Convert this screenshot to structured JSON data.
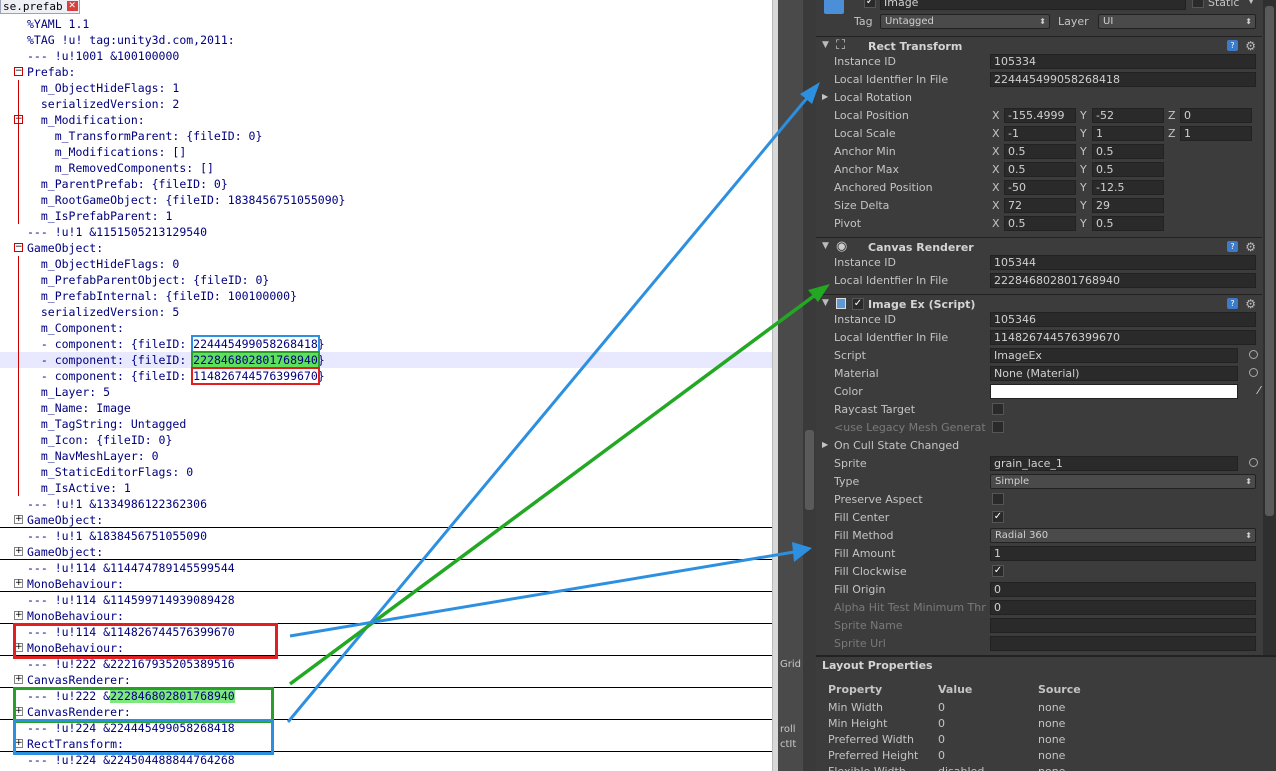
{
  "editor": {
    "tab_title": "se.prefab",
    "lines": [
      {
        "text": "%YAML 1.1",
        "kind": "plain"
      },
      {
        "text": "%TAG !u! tag:unity3d.com,2011:",
        "kind": "plain"
      },
      {
        "text": "--- !u!1001 &100100000",
        "kind": "doc"
      },
      {
        "text": "Prefab:",
        "kind": "key",
        "fold": "-"
      },
      {
        "text": "  m_ObjectHideFlags: 1",
        "kind": "kv"
      },
      {
        "text": "  serializedVersion: 2",
        "kind": "kv"
      },
      {
        "text": "  m_Modification:",
        "kind": "kv",
        "fold": "-"
      },
      {
        "text": "    m_TransformParent: {fileID: 0}",
        "kind": "kv"
      },
      {
        "text": "    m_Modifications: []",
        "kind": "kv"
      },
      {
        "text": "    m_RemovedComponents: []",
        "kind": "kv"
      },
      {
        "text": "  m_ParentPrefab: {fileID: 0}",
        "kind": "kv"
      },
      {
        "text": "  m_RootGameObject: {fileID: 1838456751055090}",
        "kind": "kv"
      },
      {
        "text": "  m_IsPrefabParent: 1",
        "kind": "kv"
      },
      {
        "text": "--- !u!1 &1151505213129540",
        "kind": "doc"
      },
      {
        "text": "GameObject:",
        "kind": "key",
        "fold": "-"
      },
      {
        "text": "  m_ObjectHideFlags: 0",
        "kind": "kv"
      },
      {
        "text": "  m_PrefabParentObject: {fileID: 0}",
        "kind": "kv"
      },
      {
        "text": "  m_PrefabInternal: {fileID: 100100000}",
        "kind": "kv"
      },
      {
        "text": "  serializedVersion: 5",
        "kind": "kv"
      },
      {
        "text": "  m_Component:",
        "kind": "kv"
      },
      {
        "text": "  - component: {fileID: 224445499058268418}",
        "kind": "kv",
        "hl": "blue"
      },
      {
        "text": "  - component: {fileID: 222846802801768940}",
        "kind": "kv",
        "hl": "green",
        "cur": true
      },
      {
        "text": "  - component: {fileID: 114826744576399670}",
        "kind": "kv",
        "hl": "red"
      },
      {
        "text": "  m_Layer: 5",
        "kind": "kv"
      },
      {
        "text": "  m_Name: Image",
        "kind": "kv"
      },
      {
        "text": "  m_TagString: Untagged",
        "kind": "kv"
      },
      {
        "text": "  m_Icon: {fileID: 0}",
        "kind": "kv"
      },
      {
        "text": "  m_NavMeshLayer: 0",
        "kind": "kv"
      },
      {
        "text": "  m_StaticEditorFlags: 0",
        "kind": "kv"
      },
      {
        "text": "  m_IsActive: 1",
        "kind": "kv"
      },
      {
        "text": "--- !u!1 &1334986122362306",
        "kind": "doc"
      },
      {
        "text": "GameObject:",
        "kind": "key",
        "fold": "+",
        "sep": true
      },
      {
        "text": "--- !u!1 &1838456751055090",
        "kind": "doc"
      },
      {
        "text": "GameObject:",
        "kind": "key",
        "fold": "+",
        "sep": true
      },
      {
        "text": "--- !u!114 &114474789145599544",
        "kind": "doc"
      },
      {
        "text": "MonoBehaviour:",
        "kind": "key",
        "fold": "+",
        "sep": true
      },
      {
        "text": "--- !u!114 &114599714939089428",
        "kind": "doc"
      },
      {
        "text": "MonoBehaviour:",
        "kind": "key",
        "fold": "+",
        "sep": true
      },
      {
        "text": "--- !u!114 &114826744576399670",
        "kind": "doc"
      },
      {
        "text": "MonoBehaviour:",
        "kind": "key",
        "fold": "+",
        "sep": true
      },
      {
        "text": "--- !u!222 &222167935205389516",
        "kind": "doc"
      },
      {
        "text": "CanvasRenderer:",
        "kind": "key",
        "fold": "+",
        "sep": true
      },
      {
        "text": "--- !u!222 &222846802801768940",
        "kind": "doc",
        "hl": "greenid"
      },
      {
        "text": "CanvasRenderer:",
        "kind": "key",
        "fold": "+",
        "sep": true
      },
      {
        "text": "--- !u!224 &224445499058268418",
        "kind": "doc"
      },
      {
        "text": "RectTransform:",
        "kind": "key",
        "fold": "+",
        "sep": true
      },
      {
        "text": "--- !u!224 &224504488844764268",
        "kind": "doc"
      }
    ]
  },
  "middle": {
    "grid_label": "Grid",
    "scroll_label": "roll",
    "edit_label": "ctIt"
  },
  "inspector": {
    "object_name": "Image",
    "static_label": "Static",
    "tag_label": "Tag",
    "tag_value": "Untagged",
    "layer_label": "Layer",
    "layer_value": "UI",
    "rect": {
      "title": "Rect Transform",
      "instance_id_label": "Instance ID",
      "instance_id": "105334",
      "local_id_label": "Local Identfier In File",
      "local_id": "224445499058268418",
      "local_rotation": "Local Rotation",
      "local_position": "Local Position",
      "pos": [
        "-155.4999",
        "-52",
        "0"
      ],
      "local_scale": "Local Scale",
      "scale": [
        "-1",
        "1",
        "1"
      ],
      "anchor_min": "Anchor Min",
      "amin": [
        "0.5",
        "0.5"
      ],
      "anchor_max": "Anchor Max",
      "amax": [
        "0.5",
        "0.5"
      ],
      "anchored_position": "Anchored Position",
      "apos": [
        "-50",
        "-12.5"
      ],
      "size_delta": "Size Delta",
      "sd": [
        "72",
        "29"
      ],
      "pivot": "Pivot",
      "pv": [
        "0.5",
        "0.5"
      ]
    },
    "canvas": {
      "title": "Canvas Renderer",
      "instance_id_label": "Instance ID",
      "instance_id": "105344",
      "local_id_label": "Local Identfier In File",
      "local_id": "222846802801768940"
    },
    "imageex": {
      "title": "Image Ex (Script)",
      "instance_id_label": "Instance ID",
      "instance_id": "105346",
      "local_id_label": "Local Identfier In File",
      "local_id": "114826744576399670",
      "script_label": "Script",
      "script_value": "ImageEx",
      "material_label": "Material",
      "material_value": "None (Material)",
      "color_label": "Color",
      "raycast_label": "Raycast Target",
      "legacy_label": "<use Legacy Mesh Generat",
      "cull_label": "On Cull State Changed",
      "sprite_label": "Sprite",
      "sprite_value": "grain_lace_1",
      "type_label": "Type",
      "type_value": "Simple",
      "preserve_label": "Preserve Aspect",
      "fill_center_label": "Fill Center",
      "fill_method_label": "Fill Method",
      "fill_method_value": "Radial 360",
      "fill_amount_label": "Fill Amount",
      "fill_amount_value": "1",
      "fill_clockwise_label": "Fill Clockwise",
      "fill_origin_label": "Fill Origin",
      "fill_origin_value": "0",
      "alpha_label": "Alpha Hit Test Minimum Thr",
      "alpha_value": "0",
      "sprite_name_label": "Sprite Name",
      "sprite_url_label": "Sprite Url"
    },
    "xyz": [
      "X",
      "Y",
      "Z"
    ],
    "check_mark": "✓"
  },
  "layout_props": {
    "title": "Layout Properties",
    "headers": [
      "Property",
      "Value",
      "Source"
    ],
    "rows": [
      [
        "Min Width",
        "0",
        "none"
      ],
      [
        "Min Height",
        "0",
        "none"
      ],
      [
        "Preferred Width",
        "0",
        "none"
      ],
      [
        "Preferred Height",
        "0",
        "none"
      ],
      [
        "Flexible Width",
        "disabled",
        "none"
      ]
    ]
  },
  "colors": {
    "blue": "#2c8fe0",
    "green": "#22a822",
    "red": "#e02020"
  }
}
